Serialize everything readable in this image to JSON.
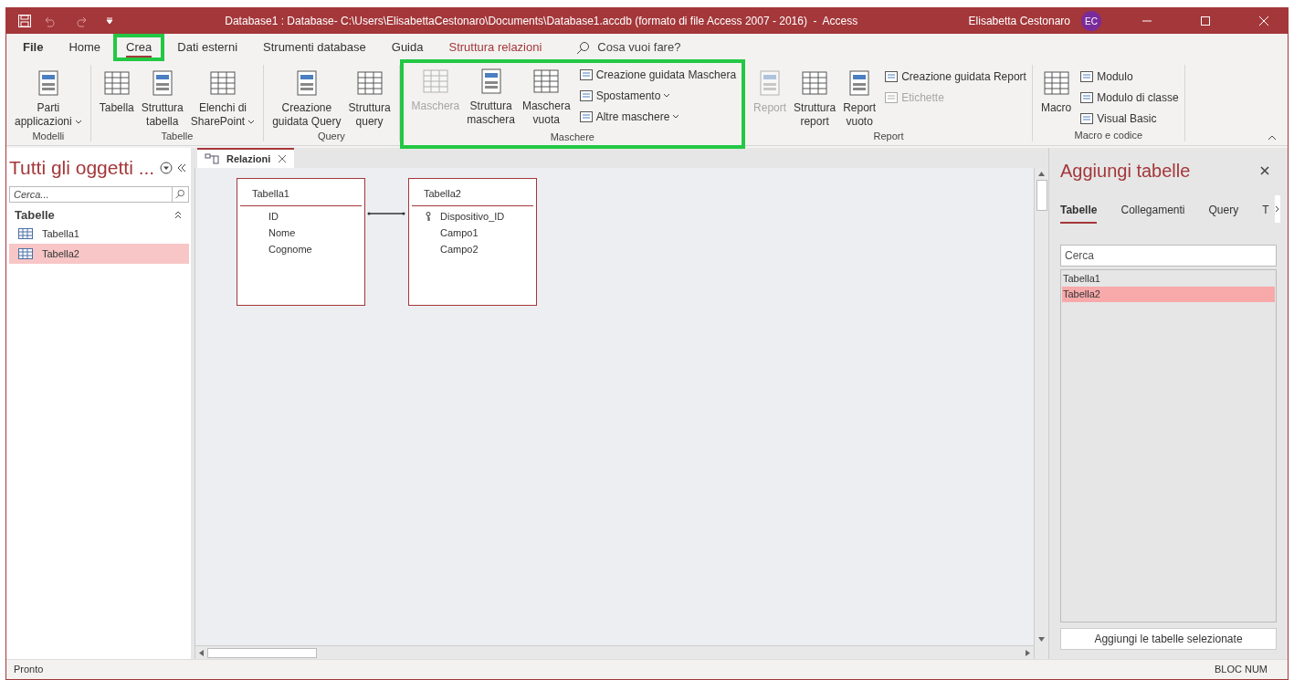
{
  "window": {
    "title": "Database1 : Database- C:\\Users\\ElisabettaCestonaro\\Documents\\Database1.accdb (formato di file Access 2007 - 2016)  -  Access",
    "user": "Elisabetta Cestonaro",
    "avatar": "EC"
  },
  "tabs": [
    {
      "label": "File",
      "kind": "file",
      "selected": false,
      "highlighted": false
    },
    {
      "label": "Home",
      "kind": "normal",
      "selected": false,
      "highlighted": false
    },
    {
      "label": "Crea",
      "kind": "normal",
      "selected": true,
      "highlighted": true
    },
    {
      "label": "Dati esterni",
      "kind": "normal",
      "selected": false,
      "highlighted": false
    },
    {
      "label": "Strumenti database",
      "kind": "normal",
      "selected": false,
      "highlighted": false
    },
    {
      "label": "Guida",
      "kind": "normal",
      "selected": false,
      "highlighted": false
    },
    {
      "label": "Struttura relazioni",
      "kind": "contextual",
      "selected": false,
      "highlighted": false
    }
  ],
  "tell_me": {
    "placeholder": "Cosa vuoi fare?"
  },
  "ribbon": [
    {
      "label": "Modelli",
      "highlighted": false,
      "buttons": [
        {
          "kind": "large",
          "lines": [
            "Parti",
            "applicazioni"
          ],
          "dropdown": true,
          "disabled": false
        }
      ]
    },
    {
      "label": "Tabelle",
      "highlighted": false,
      "buttons": [
        {
          "kind": "large",
          "lines": [
            "Tabella"
          ],
          "dropdown": false,
          "disabled": false
        },
        {
          "kind": "large",
          "lines": [
            "Struttura",
            "tabella"
          ],
          "dropdown": false,
          "disabled": false
        },
        {
          "kind": "large",
          "lines": [
            "Elenchi di",
            "SharePoint"
          ],
          "dropdown": true,
          "disabled": false
        }
      ]
    },
    {
      "label": "Query",
      "highlighted": false,
      "buttons": [
        {
          "kind": "large",
          "lines": [
            "Creazione",
            "guidata Query"
          ],
          "dropdown": false,
          "disabled": false
        },
        {
          "kind": "large",
          "lines": [
            "Struttura",
            "query"
          ],
          "dropdown": false,
          "disabled": false
        }
      ]
    },
    {
      "label": "Maschere",
      "highlighted": true,
      "buttons": [
        {
          "kind": "large",
          "lines": [
            "Maschera"
          ],
          "dropdown": false,
          "disabled": true
        },
        {
          "kind": "large",
          "lines": [
            "Struttura",
            "maschera"
          ],
          "dropdown": false,
          "disabled": false
        },
        {
          "kind": "large",
          "lines": [
            "Maschera",
            "vuota"
          ],
          "dropdown": false,
          "disabled": false
        },
        {
          "kind": "small",
          "lines": [
            "Creazione guidata Maschera"
          ],
          "dropdown": false,
          "disabled": false
        },
        {
          "kind": "small",
          "lines": [
            "Spostamento"
          ],
          "dropdown": true,
          "disabled": false
        },
        {
          "kind": "small",
          "lines": [
            "Altre maschere"
          ],
          "dropdown": true,
          "disabled": false
        }
      ]
    },
    {
      "label": "Report",
      "highlighted": false,
      "buttons": [
        {
          "kind": "large",
          "lines": [
            "Report"
          ],
          "dropdown": false,
          "disabled": true
        },
        {
          "kind": "large",
          "lines": [
            "Struttura",
            "report"
          ],
          "dropdown": false,
          "disabled": false
        },
        {
          "kind": "large",
          "lines": [
            "Report",
            "vuoto"
          ],
          "dropdown": false,
          "disabled": false
        },
        {
          "kind": "small",
          "lines": [
            "Creazione guidata Report"
          ],
          "dropdown": false,
          "disabled": false
        },
        {
          "kind": "small",
          "lines": [
            "Etichette"
          ],
          "dropdown": false,
          "disabled": true
        }
      ]
    },
    {
      "label": "Macro e codice",
      "highlighted": false,
      "buttons": [
        {
          "kind": "large",
          "lines": [
            "Macro"
          ],
          "dropdown": false,
          "disabled": false
        },
        {
          "kind": "small",
          "lines": [
            "Modulo"
          ],
          "dropdown": false,
          "disabled": false
        },
        {
          "kind": "small",
          "lines": [
            "Modulo di classe"
          ],
          "dropdown": false,
          "disabled": false
        },
        {
          "kind": "small",
          "lines": [
            "Visual Basic"
          ],
          "dropdown": false,
          "disabled": false
        }
      ]
    }
  ],
  "nav_pane": {
    "title": "Tutti gli oggetti ...",
    "search": {
      "placeholder": "Cerca..."
    },
    "group": "Tabelle",
    "items": [
      {
        "label": "Tabella1",
        "selected": false
      },
      {
        "label": "Tabella2",
        "selected": true
      }
    ]
  },
  "document_tab": {
    "label": "Relazioni"
  },
  "diagram": {
    "tables": [
      {
        "name": "Tabella1",
        "fields": [
          {
            "name": "ID",
            "primary_key": false
          },
          {
            "name": "Nome",
            "primary_key": false
          },
          {
            "name": "Cognome",
            "primary_key": false
          }
        ]
      },
      {
        "name": "Tabella2",
        "fields": [
          {
            "name": "Dispositivo_ID",
            "primary_key": true
          },
          {
            "name": "Campo1",
            "primary_key": false
          },
          {
            "name": "Campo2",
            "primary_key": false
          }
        ]
      }
    ]
  },
  "add_tables_pane": {
    "title": "Aggiungi tabelle",
    "tabs": [
      {
        "label": "Tabelle",
        "selected": true
      },
      {
        "label": "Collegamenti",
        "selected": false
      },
      {
        "label": "Query",
        "selected": false
      },
      {
        "label": "T",
        "selected": false
      }
    ],
    "search": {
      "placeholder": "Cerca"
    },
    "items": [
      {
        "label": "Tabella1",
        "selected": false
      },
      {
        "label": "Tabella2",
        "selected": true
      }
    ],
    "button": "Aggiungi le tabelle selezionate"
  },
  "status_bar": {
    "left": "Pronto",
    "right": "BLOC NUM"
  }
}
